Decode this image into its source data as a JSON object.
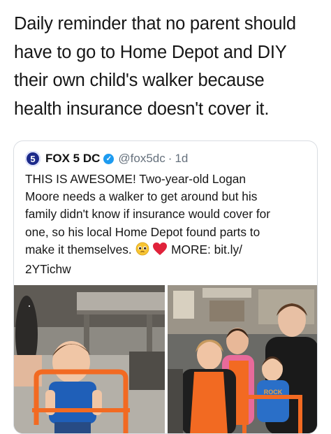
{
  "caption": {
    "line1": "Daily reminder that no parent should",
    "line2": "have to go to Home Depot and DIY",
    "line3": "their own child's walker because",
    "line4": "health insurance doesn't cover it."
  },
  "tweet": {
    "avatar_text": "5",
    "name": "FOX 5 DC",
    "handle": "@fox5dc",
    "separator": "·",
    "time": "1d",
    "line1": "THIS IS AWESOME! Two-year-old Logan",
    "line2": "Moore needs a walker to get around but his",
    "line3": "family didn't know if insurance would cover for",
    "line4": "one, so his local Home Depot found parts to",
    "line5_before": "make it themselves.",
    "line5_after": "MORE: bit.ly/",
    "line6": "2YTichw",
    "shirt_text": "ROCK"
  },
  "icons": {
    "avatar": "fox5-logo-icon",
    "verified": "verified-badge-icon",
    "emoji1": "pleading-face-icon",
    "emoji2": "red-heart-icon"
  },
  "colors": {
    "verified": "#1d9bf0",
    "fox_blue": "#1c2a8a",
    "handle": "#66717d",
    "heart": "#e0223a",
    "walker_orange": "#f26a22"
  }
}
